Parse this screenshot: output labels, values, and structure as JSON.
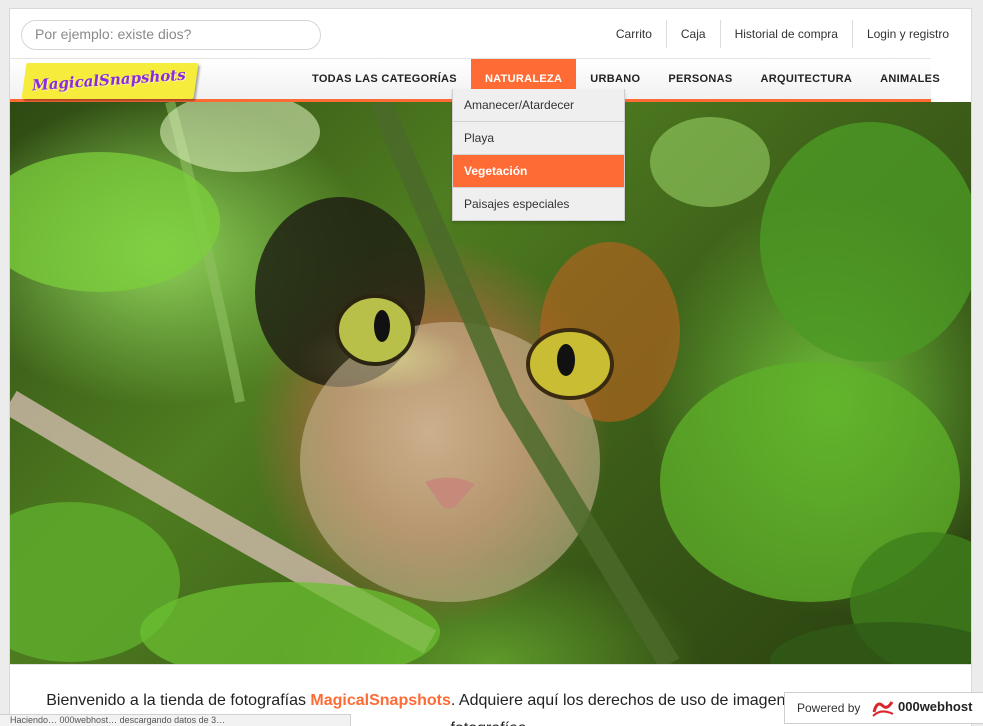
{
  "search": {
    "placeholder": "Por ejemplo: existe dios?"
  },
  "toplinks": [
    "Carrito",
    "Caja",
    "Historial de compra",
    "Login y registro"
  ],
  "logo": {
    "text": "MagicalSnapshots"
  },
  "nav": {
    "items": [
      "TODAS LAS CATEGORÍAS",
      "NATURALEZA",
      "URBANO",
      "PERSONAS",
      "ARQUITECTURA",
      "ANIMALES"
    ],
    "active": "NATURALEZA"
  },
  "dropdown": {
    "items": [
      "Amanecer/Atardecer",
      "Playa",
      "Vegetación",
      "Paisajes especiales"
    ],
    "active": "Vegetación"
  },
  "welcome": {
    "prefix": "Bienvenido a la tienda de fotografías ",
    "brand": "MagicalSnapshots",
    "suffix": ". Adquiere aquí los derechos de uso de imagen de nuestras mejores fotografías."
  },
  "status_bar": "Haciendo… 000webhost… descargando datos de 3…",
  "powered": {
    "label": "Powered by",
    "name": "000webhost"
  },
  "colors": {
    "accent": "#ff6b35",
    "logo_bg": "#f6ec3c",
    "logo_text": "#8a2be2"
  }
}
